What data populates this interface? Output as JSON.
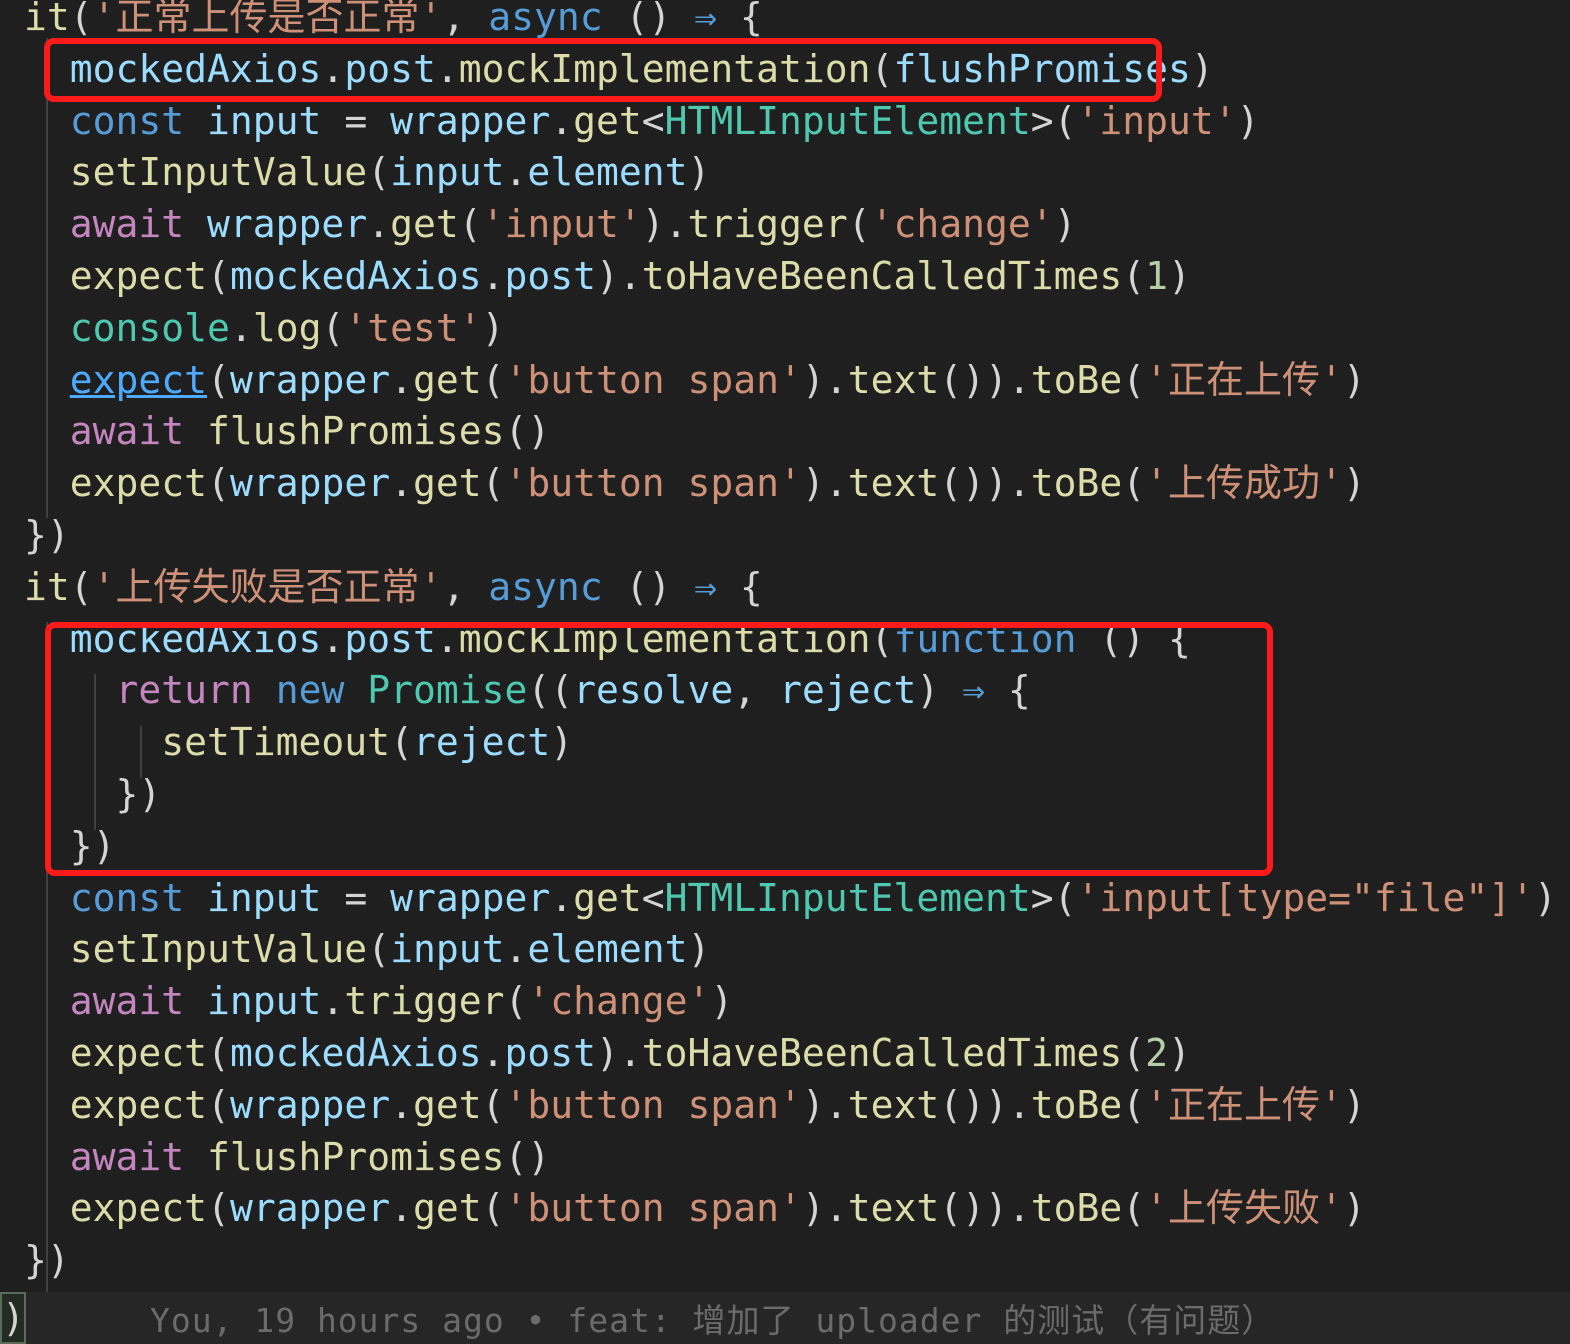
{
  "editor": {
    "background": "#1f1f1f",
    "highlight_color": "#fb1b1b",
    "language": "typescript",
    "lines": [
      {
        "indent": 0,
        "raw": "it('正常上传是否正常', async () ⇒ {"
      },
      {
        "indent": 1,
        "raw": "mockedAxios.post.mockImplementation(flushPromises)"
      },
      {
        "indent": 1,
        "raw": "const input = wrapper.get<HTMLInputElement>('input')"
      },
      {
        "indent": 1,
        "raw": "setInputValue(input.element)"
      },
      {
        "indent": 1,
        "raw": "await wrapper.get('input').trigger('change')"
      },
      {
        "indent": 1,
        "raw": "expect(mockedAxios.post).toHaveBeenCalledTimes(1)"
      },
      {
        "indent": 1,
        "raw": "console.log('test')"
      },
      {
        "indent": 1,
        "raw": "expect(wrapper.get('button span').text()).toBe('正在上传')"
      },
      {
        "indent": 1,
        "raw": "await flushPromises()"
      },
      {
        "indent": 1,
        "raw": "expect(wrapper.get('button span').text()).toBe('上传成功')"
      },
      {
        "indent": 0,
        "raw": "})"
      },
      {
        "indent": 0,
        "raw": "it('上传失败是否正常', async () ⇒ {"
      },
      {
        "indent": 1,
        "raw": "mockedAxios.post.mockImplementation(function () {"
      },
      {
        "indent": 2,
        "raw": "return new Promise((resolve, reject) ⇒ {"
      },
      {
        "indent": 3,
        "raw": "setTimeout(reject)"
      },
      {
        "indent": 2,
        "raw": "})"
      },
      {
        "indent": 1,
        "raw": "})"
      },
      {
        "indent": 1,
        "raw": "const input = wrapper.get<HTMLInputElement>('input[type=\"file\"]')"
      },
      {
        "indent": 1,
        "raw": "setInputValue(input.element)"
      },
      {
        "indent": 1,
        "raw": "await input.trigger('change')"
      },
      {
        "indent": 1,
        "raw": "expect(mockedAxios.post).toHaveBeenCalledTimes(2)"
      },
      {
        "indent": 1,
        "raw": "expect(wrapper.get('button span').text()).toBe('正在上传')"
      },
      {
        "indent": 1,
        "raw": "await flushPromises()"
      },
      {
        "indent": 1,
        "raw": "expect(wrapper.get('button span').text()).toBe('上传失败')"
      },
      {
        "indent": 0,
        "raw": "})"
      }
    ],
    "annotations": [
      {
        "label": "highlight-box-1",
        "target_line": "mockedAxios.post.mockImplementation(flushPromises)"
      },
      {
        "label": "highlight-box-2",
        "target_line": "mockedAxios.post.mockImplementation(function () { ... })"
      }
    ]
  },
  "blame": {
    "cursor_char": ")",
    "author": "You",
    "time": "19 hours ago",
    "separator": "•",
    "message": "feat: 增加了 uploader 的测试（有问题）",
    "full_text": "You, 19 hours ago • feat: 增加了 uploader 的测试（有问题）"
  }
}
